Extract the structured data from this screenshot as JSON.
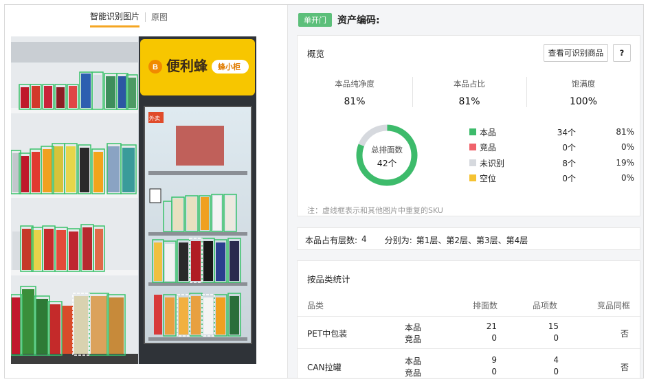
{
  "tabs": [
    {
      "label": "智能识别图片"
    },
    {
      "label": "原图"
    }
  ],
  "photo": {
    "brand": "便利蜂",
    "tag": "蜂小柜",
    "fridge_logo": "外卖"
  },
  "header": {
    "badge": "单开门",
    "asset_label": "资产编码:"
  },
  "overview": {
    "title": "概览",
    "btn_view": "查看可识别商品",
    "btn_help": "?",
    "stats": [
      {
        "label": "本品纯净度",
        "value": "81%"
      },
      {
        "label": "本品占比",
        "value": "81%"
      },
      {
        "label": "饱满度",
        "value": "100%"
      }
    ],
    "donut": {
      "label": "总排面数",
      "value": "42个",
      "segments": [
        34,
        0,
        8,
        0
      ]
    },
    "legend": [
      {
        "name": "本品",
        "count": "34个",
        "pct": "81%",
        "color": "#3dbb6b"
      },
      {
        "name": "竞品",
        "count": "0个",
        "pct": "0%",
        "color": "#f0636b"
      },
      {
        "name": "未识别",
        "count": "8个",
        "pct": "19%",
        "color": "#d6d9de"
      },
      {
        "name": "空位",
        "count": "0个",
        "pct": "0%",
        "color": "#f5c232"
      }
    ],
    "note": "注：虚线框表示和其他图片中重复的SKU"
  },
  "layers": {
    "label": "本品占有层数:",
    "count": "4",
    "detail_label": "分别为:",
    "detail": "第1层、第2层、第3层、第4层"
  },
  "category": {
    "title": "按品类统计",
    "headers": [
      "品类",
      "排面数",
      "品项数",
      "竞品同框"
    ],
    "rows": [
      {
        "name": "PET中包装",
        "t1": "本品",
        "t2": "竞品",
        "f1": "21",
        "f2": "0",
        "s1": "15",
        "s2": "0",
        "comp": "否"
      },
      {
        "name": "CAN拉罐",
        "t1": "本品",
        "t2": "竞品",
        "f1": "9",
        "f2": "0",
        "s1": "4",
        "s2": "0",
        "comp": "否"
      }
    ]
  },
  "colors": {
    "accent": "#f5a623",
    "green": "#5cbf7a",
    "brand_yellow": "#f7c600"
  }
}
